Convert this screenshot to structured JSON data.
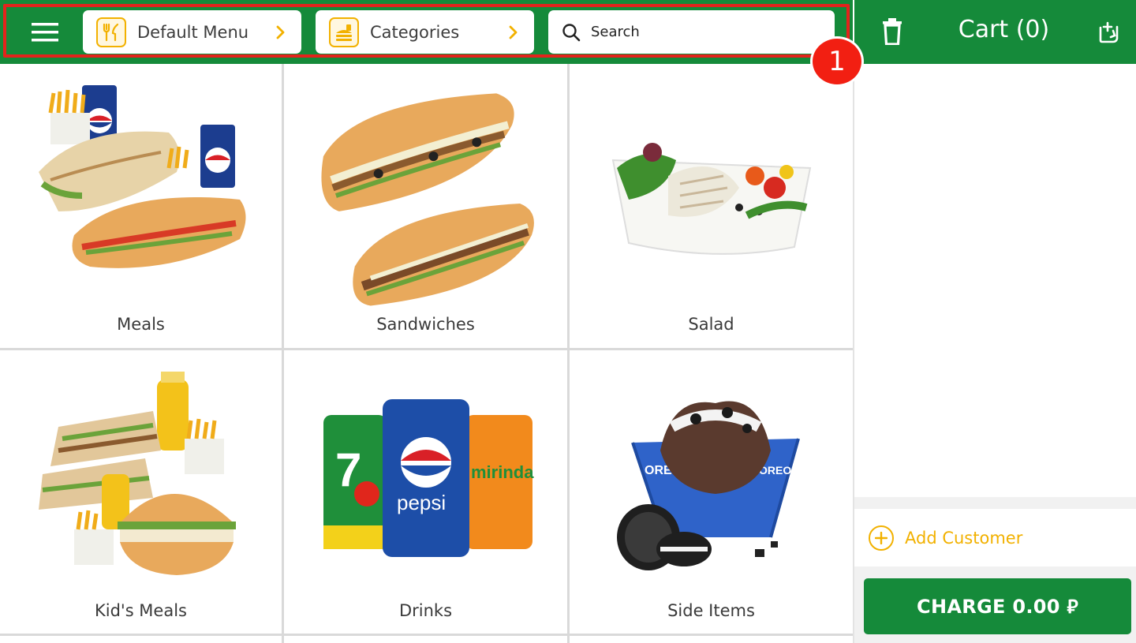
{
  "header": {
    "menu_label": "Default Menu",
    "categories_label": "Categories",
    "search_placeholder": "Search",
    "step_number": "1"
  },
  "cart": {
    "title": "Cart (0)",
    "add_customer_label": "Add Customer",
    "charge_label": "CHARGE 0.00 ⃁"
  },
  "categories": [
    {
      "name": "Meals"
    },
    {
      "name": "Sandwiches"
    },
    {
      "name": "Salad"
    },
    {
      "name": "Kid's Meals"
    },
    {
      "name": "Drinks"
    },
    {
      "name": "Side Items"
    }
  ],
  "colors": {
    "brand_green": "#158a3a",
    "accent_yellow": "#f2b100",
    "highlight_red": "#e3231c"
  }
}
